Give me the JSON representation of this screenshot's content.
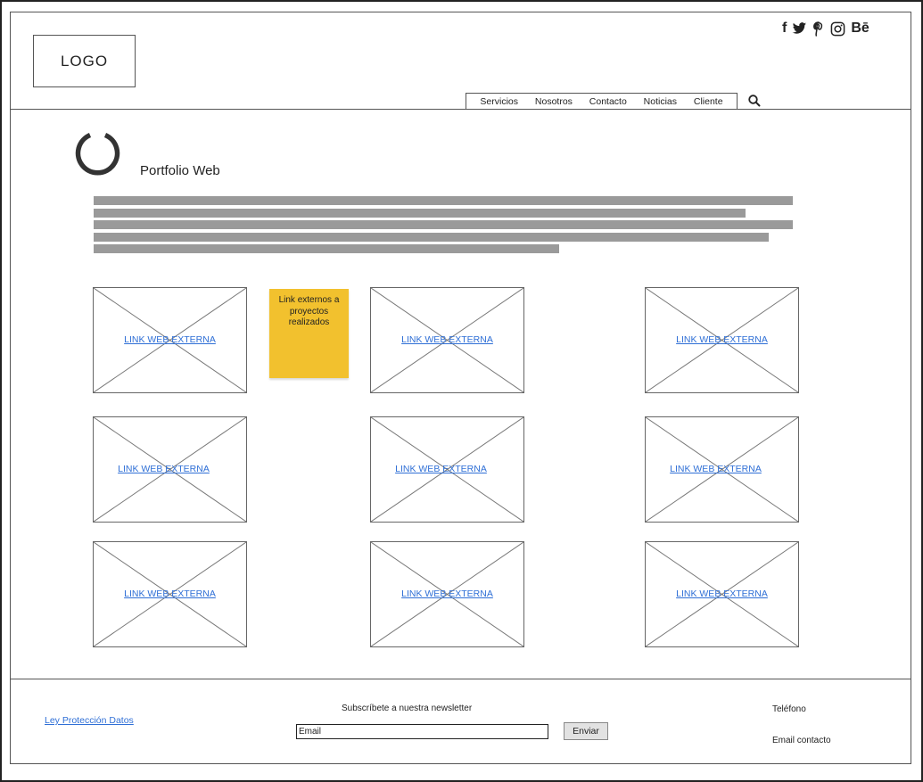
{
  "header": {
    "logo": "LOGO",
    "social": [
      {
        "icon": "facebook-icon",
        "glyph": "f"
      },
      {
        "icon": "twitter-icon",
        "glyph": "🐦"
      },
      {
        "icon": "pinterest-icon",
        "glyph": "P"
      },
      {
        "icon": "instagram-icon",
        "glyph": "◎"
      },
      {
        "icon": "behance-icon",
        "glyph": "Bē"
      }
    ],
    "nav": [
      "Servicios",
      "Nosotros",
      "Contacto",
      "Noticias",
      "Cliente"
    ],
    "search_icon": "search-icon"
  },
  "main": {
    "title": "Portfolio Web",
    "spinner_icon": "loading-icon",
    "sticky_note": "Link externos a proyectos realizados",
    "cards": [
      "LINK WEB EXTERNA",
      "LINK WEB EXTERNA",
      "LINK WEB EXTERNA",
      "LINK WEB EXTERNA",
      "LINK WEB EXTERNA",
      "LINK WEB EXTERNA",
      "LINK WEB EXTERNA",
      "LINK WEB EXTERNA",
      "LINK WEB EXTERNA"
    ]
  },
  "footer": {
    "privacy_link": "Ley Protección Datos",
    "newsletter_label": "Subscríbete a nuestra newsletter",
    "email_placeholder": "Email",
    "send_label": "Enviar",
    "phone": "Teléfono",
    "email_contact": "Email contacto"
  },
  "colors": {
    "link": "#2f6fd6",
    "sticky": "#f2c12e",
    "text_bar": "#9a9a9a"
  }
}
